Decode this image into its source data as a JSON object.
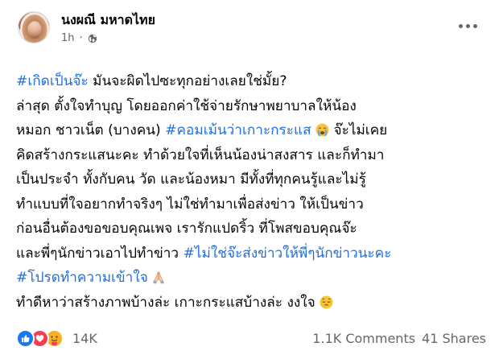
{
  "post": {
    "author": "นงผณี มหาดไทย",
    "time": "1h",
    "separator": "·",
    "privacy_icon": "globe-icon",
    "more_icon": "more-horizontal-icon",
    "lines": [
      [
        {
          "t": "#เกิดเป็นจ๊ะ",
          "tag": true
        },
        {
          "t": " มันจะผิดไปซะทุกอย่างเลยใช่มั้ย?"
        }
      ],
      [
        {
          "t": "  ล่าสุด ตั้งใจทำบุญ โดยออกค่าใช้จ่ายรักษาพยาบาลให้น้อง"
        }
      ],
      [
        {
          "t": "หมอก ชาวเน็ต (บางคน) "
        },
        {
          "t": "#คอมเม้นว่าเกาะกระแส",
          "tag": true
        },
        {
          "t": " "
        },
        {
          "emoji": "crying-face-emoji"
        },
        {
          "t": "  จ๊ะไม่เคย"
        }
      ],
      [
        {
          "t": "คิดสร้างกระแสนะคะ ทำด้วยใจที่เห็นน้องน่าสงสาร และก็ทำมา"
        }
      ],
      [
        {
          "t": "เป็นประจำ ทั้งกับคน วัด และน้องหมา มีทั้งที่ทุกคนรู้และไม่รู้"
        }
      ],
      [
        {
          "t": "ทำแบบที่ใจอยากทำจริงๆ ไม่ใช่ทำมาเพื่อส่งข่าว ให้เป็นข่าว"
        }
      ],
      [
        {
          "t": "ก่อนอื่นต้องขอขอบคุณเพจ เรารักแปดริ้ว ที่โพสขอบคุณจ๊ะ"
        }
      ],
      [
        {
          "t": "และพี่ๆนักข่าวเอาไปทำข่าว "
        },
        {
          "t": "#ไม่ใช่จ๊ะส่งข่าวให้พี่ๆนักข่าวนะคะ",
          "tag": true
        }
      ],
      [
        {
          "t": "#โปรดทำความเข้าใจ",
          "tag": true
        },
        {
          "t": " "
        },
        {
          "emoji": "folded-hands-emoji"
        }
      ],
      [
        {
          "t": "  ทำดีหาว่าสร้างภาพบ้างล่ะ เกาะกระแสบ้างล่ะ งงใจ  "
        },
        {
          "emoji": "pensive-face-emoji"
        }
      ]
    ],
    "reactions": [
      "like-icon",
      "love-icon",
      "care-icon"
    ],
    "reaction_count": "14K",
    "comments": "1.1K Comments",
    "shares": "41 Shares",
    "colors": {
      "hashtag": "#216fdb",
      "secondary": "#65676b",
      "like": "#1877f2",
      "love": "#f33e58",
      "care": "#f7b125"
    }
  }
}
